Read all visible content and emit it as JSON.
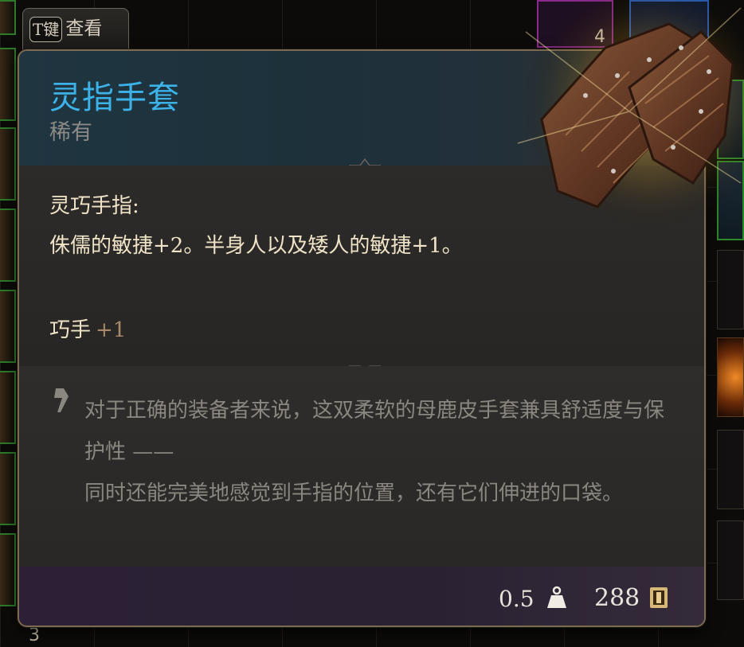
{
  "hint": {
    "key": "T键",
    "label": "查看"
  },
  "item": {
    "name": "灵指手套",
    "rarity": "稀有",
    "effect_title": "灵巧手指:",
    "effect_desc": "侏儒的敏捷+2。半身人以及矮人的敏捷+1。",
    "ability_name": "巧手",
    "ability_value": "+1",
    "flavor_line1": "对于正确的装备者来说，这双柔软的母鹿皮手套兼具舒适度与保护性 ——",
    "flavor_line2": "同时还能完美地感觉到手指的位置，还有它们伸进的口袋。",
    "weight": "0.5",
    "price": "288"
  },
  "inventory": {
    "top_count": "4",
    "bottom_count": "3"
  },
  "icons": {
    "view_key": "keyboard-key-icon",
    "quote": "quote-mark-icon",
    "weight": "weight-icon",
    "gold": "gold-coin-icon",
    "art": "leather-gloves-art"
  },
  "colors": {
    "item_name": "#3cb2e8",
    "rarity": "#8c8a86",
    "body_text": "#f0e4c8",
    "ability_value": "#a88a6a",
    "flavor_text": "#8a8680",
    "border": "#7c6a52"
  }
}
